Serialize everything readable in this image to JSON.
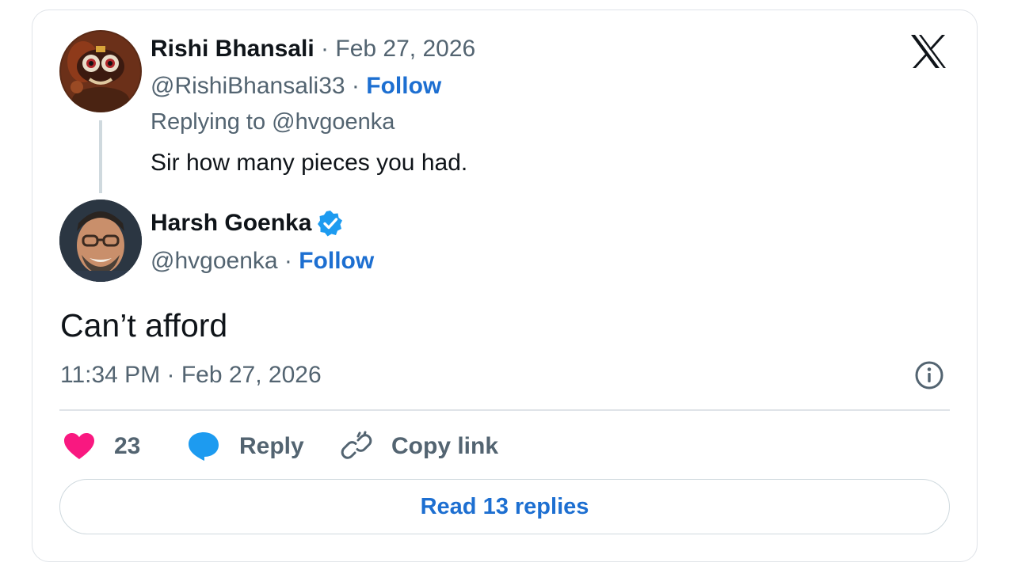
{
  "reply_tweet": {
    "author_name": "Rishi Bhansali",
    "date": "Feb 27, 2026",
    "handle": "@RishiBhansali33",
    "follow_label": "Follow",
    "replying_prefix": "Replying to",
    "replying_to": "@hvgoenka",
    "text": "Sir how many pieces you had."
  },
  "main_tweet": {
    "author_name": "Harsh Goenka",
    "verified": true,
    "handle": "@hvgoenka",
    "follow_label": "Follow",
    "text": "Can’t afford",
    "timestamp": "11:34 PM · Feb 27, 2026"
  },
  "actions": {
    "like_count": "23",
    "reply_label": "Reply",
    "copy_link_label": "Copy link"
  },
  "read_replies_label": "Read 13 replies",
  "icons": [
    "x-logo-icon",
    "verified-badge-icon",
    "info-icon",
    "heart-icon",
    "reply-bubble-icon",
    "link-icon"
  ],
  "colors": {
    "link_blue": "#1d6fd1",
    "like_pink": "#f91880",
    "reply_blue": "#1d9bf0",
    "muted": "#536471",
    "verified": "#1d9bf0"
  }
}
